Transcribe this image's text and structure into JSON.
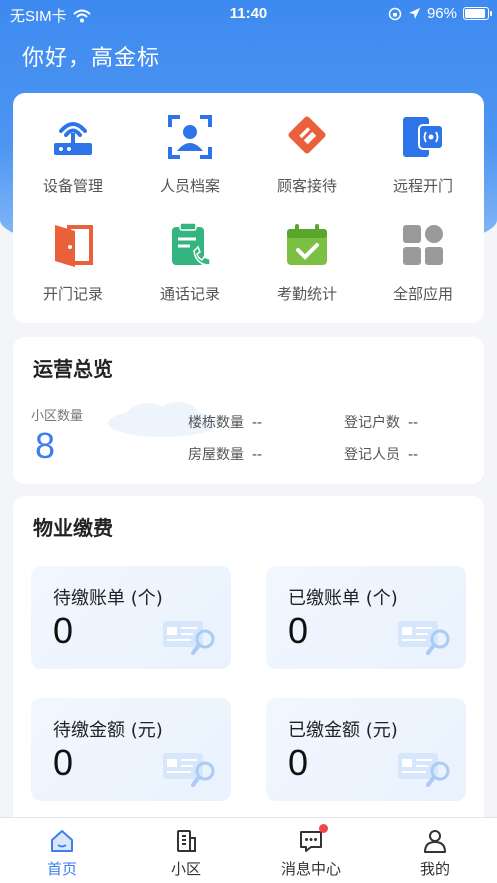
{
  "status_bar": {
    "carrier": "无SIM卡",
    "time": "11:40",
    "battery": "96%"
  },
  "greeting": "你好，高金标",
  "apps": [
    {
      "label": "设备管理",
      "icon": "router-icon"
    },
    {
      "label": "人员档案",
      "icon": "face-scan-icon"
    },
    {
      "label": "顾客接待",
      "icon": "reception-icon"
    },
    {
      "label": "远程开门",
      "icon": "remote-door-icon"
    },
    {
      "label": "开门记录",
      "icon": "door-open-icon"
    },
    {
      "label": "通话记录",
      "icon": "call-record-icon"
    },
    {
      "label": "考勤统计",
      "icon": "calendar-check-icon"
    },
    {
      "label": "全部应用",
      "icon": "grid-apps-icon"
    }
  ],
  "overview": {
    "title": "运营总览",
    "community_count_label": "小区数量",
    "community_count": "8",
    "building_label": "楼栋数量",
    "building_value": "--",
    "household_label": "登记户数",
    "household_value": "--",
    "house_label": "房屋数量",
    "house_value": "--",
    "person_label": "登记人员",
    "person_value": "--"
  },
  "fees": {
    "title": "物业缴费",
    "items": [
      {
        "label": "待缴账单 (个)",
        "value": "0"
      },
      {
        "label": "已缴账单 (个)",
        "value": "0"
      },
      {
        "label": "待缴金额 (元)",
        "value": "0"
      },
      {
        "label": "已缴金额 (元)",
        "value": "0"
      }
    ]
  },
  "tabbar": [
    {
      "label": "首页",
      "icon": "home-icon",
      "active": true
    },
    {
      "label": "小区",
      "icon": "building-icon"
    },
    {
      "label": "消息中心",
      "icon": "message-icon",
      "badge": true
    },
    {
      "label": "我的",
      "icon": "user-icon"
    }
  ],
  "colors": {
    "primary": "#3d7ef0",
    "badge": "#f04545"
  }
}
